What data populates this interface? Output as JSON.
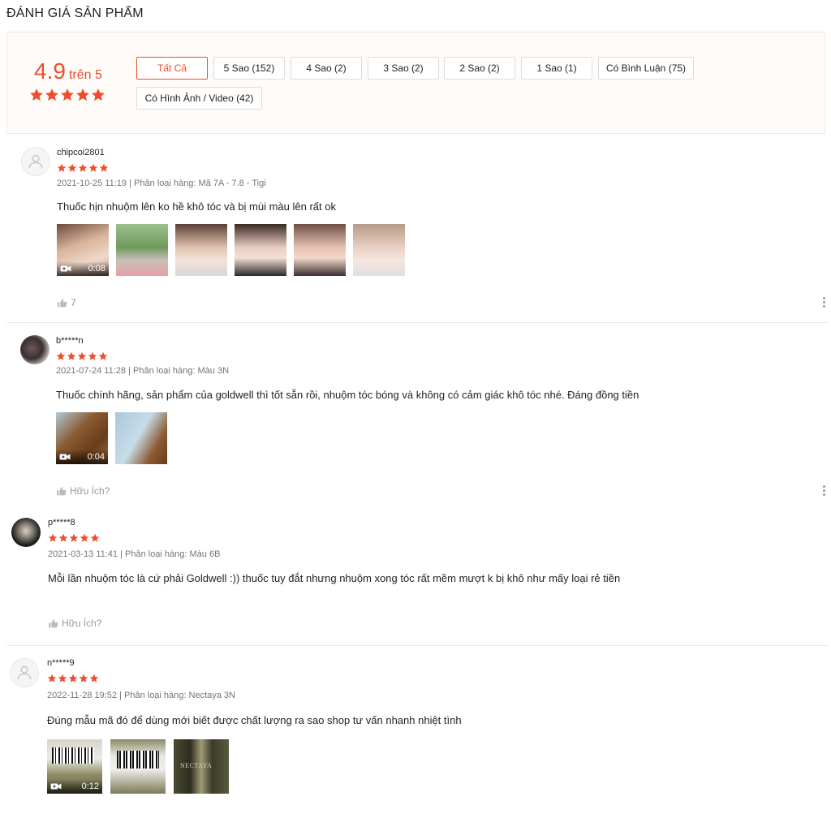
{
  "header": {
    "title": "ĐÁNH GIÁ SẢN PHẨM"
  },
  "summary": {
    "rating": "4.9",
    "rating_suffix": "trên 5",
    "rating_value": 4.9,
    "accent_color": "#ee4d2d"
  },
  "filters": [
    {
      "label": "Tất Cả",
      "active": true
    },
    {
      "label": "5 Sao (152)"
    },
    {
      "label": "4 Sao (2)"
    },
    {
      "label": "3 Sao (2)"
    },
    {
      "label": "2 Sao (2)"
    },
    {
      "label": "1 Sao (1)"
    },
    {
      "label": "Có Bình Luận (75)"
    },
    {
      "label": "Có Hình Ảnh / Video (42)"
    }
  ],
  "reviews": [
    {
      "user": "chipcoi2801",
      "stars": 5,
      "meta": "2021-10-25 11:19 | Phân loại hàng: Mã 7A - 7.8 - Tigi",
      "comment": "Thuốc hịn nhuộm lên ko hề khô tóc và bị mùi màu lên rất ok",
      "video_duration": "0:08",
      "like_text": "7"
    },
    {
      "user": "b*****n",
      "stars": 5,
      "meta": "2021-07-24 11:28 | Phân loại hàng: Màu 3N",
      "comment": "Thuốc chính hãng, sản phẩm của goldwell thì tốt sẵn rồi, nhuộm tóc bóng và không có cảm giác khô tóc nhé. Đáng đồng tiền",
      "video_duration": "0:04",
      "like_text": "Hữu Ích?"
    },
    {
      "user": "p*****8",
      "stars": 5,
      "meta": "2021-03-13 11:41 | Phân loại hàng: Màu 6B",
      "comment": "Mỗi lần nhuộm tóc là cứ phải Goldwell :)) thuốc tuy đắt nhưng nhuộm xong tóc rất mềm mượt k bị khô như mấy loại rẻ tiền",
      "like_text": "Hữu Ích?"
    },
    {
      "user": "n*****9",
      "stars": 5,
      "meta": "2022-11-28 19:52 | Phân loại hàng: Nectaya 3N",
      "comment": "Đúng mẫu mã đó để dùng mới biết được chất lượng ra sao shop tư vấn nhanh nhiệt tình",
      "video_duration": "0:12",
      "media_text": "NECTAYA"
    }
  ]
}
